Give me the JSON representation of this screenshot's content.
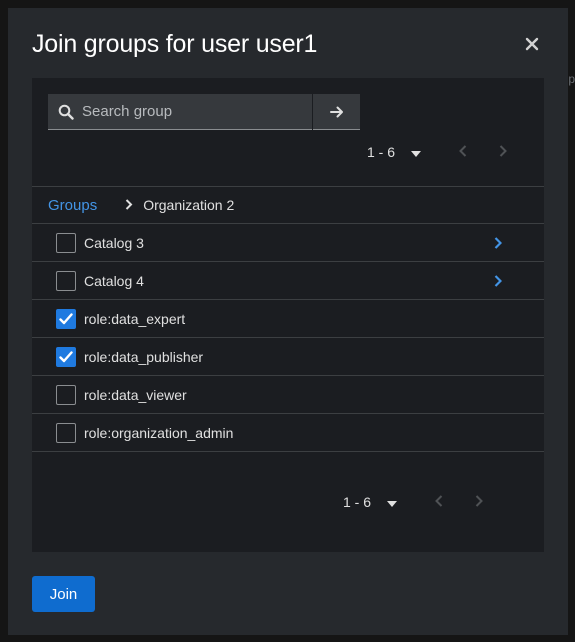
{
  "modal": {
    "title": "Join groups for user user1"
  },
  "search": {
    "placeholder": "Search group"
  },
  "pagination_top": {
    "range": "1 - 6"
  },
  "pagination_bottom": {
    "range": "1 - 6"
  },
  "breadcrumb": {
    "root": "Groups",
    "current": "Organization 2"
  },
  "groups": [
    {
      "label": "Catalog 3",
      "checked": false,
      "has_children": true
    },
    {
      "label": "Catalog 4",
      "checked": false,
      "has_children": true
    },
    {
      "label": "role:data_expert",
      "checked": true,
      "has_children": false
    },
    {
      "label": "role:data_publisher",
      "checked": true,
      "has_children": false
    },
    {
      "label": "role:data_viewer",
      "checked": false,
      "has_children": false
    },
    {
      "label": "role:organization_admin",
      "checked": false,
      "has_children": false
    }
  ],
  "actions": {
    "join_label": "Join"
  },
  "colors": {
    "accent": "#1f7ae0",
    "link": "#4394e5",
    "join_button": "#0f6ccf"
  }
}
